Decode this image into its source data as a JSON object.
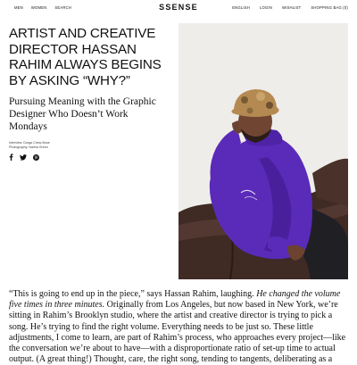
{
  "nav": {
    "left": [
      "MEN",
      "WOMEN",
      "SEARCH"
    ],
    "right": [
      "ENGLISH",
      "LOGIN",
      "WISHLIST",
      "SHOPPING BAG (0)"
    ]
  },
  "logo": "SSENSE",
  "article": {
    "headline": "ARTIST AND CREATIVE DIRECTOR HASSAN RAHIM ALWAYS BEGINS BY ASKING “WHY?”",
    "subhead": "Pursuing Meaning with the Graphic Designer Who Doesn’t Work Mondays",
    "credits": [
      "Interview: Durga Chew-Bose",
      "Photography: Naima Green"
    ],
    "share_icons": [
      "facebook-icon",
      "twitter-icon",
      "pinterest-icon"
    ],
    "body_part1": "“This is going to end up in the piece,” says Hassan Rahim, laughing. ",
    "body_italic": "He changed the volume five times in three minutes.",
    "body_part2": " Originally from Los Angeles, but now based in New York, we’re sitting in Rahim’s Brooklyn studio, where the artist and creative director is trying to pick a song. He’s trying to find the right volume. Everything needs to be just so. These little adjustments, I come to learn, are part of Rahim’s process, who approaches every project—like the conversation we’re about to have—with a disproportionate ratio of set-up time to actual output. (A great thing!) Thought, care, the right song, tending to tangents, deliberating as a"
  },
  "colors": {
    "hoodie": "#5a2ab8",
    "sofa": "#3f2a24",
    "wall": "#efedea"
  }
}
